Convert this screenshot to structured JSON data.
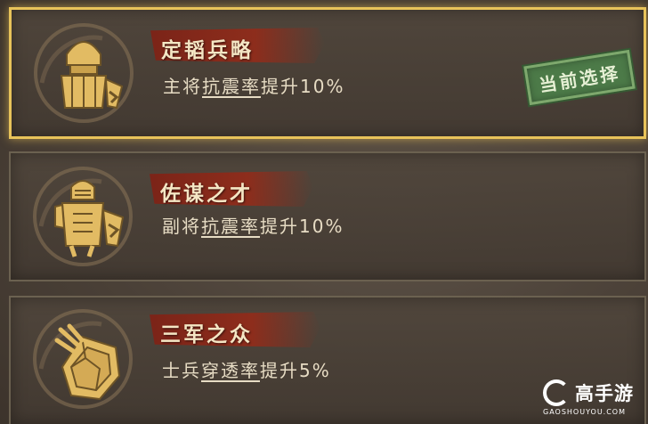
{
  "cards": [
    {
      "icon": "commander-helmet-icon",
      "title": "定韬兵略",
      "desc_prefix": "主将",
      "desc_highlight": "抗震率",
      "desc_suffix": "提升10%",
      "selected": true,
      "stamp": "当前选择"
    },
    {
      "icon": "deputy-warrior-icon",
      "title": "佐谋之才",
      "desc_prefix": "副将",
      "desc_highlight": "抗震率",
      "desc_suffix": "提升10%",
      "selected": false
    },
    {
      "icon": "broken-shield-icon",
      "title": "三军之众",
      "desc_prefix": "士兵",
      "desc_highlight": "穿透率",
      "desc_suffix": "提升5%",
      "selected": false
    }
  ],
  "watermark": {
    "brand": "高手游",
    "url": "GAOSHOUYOU.COM"
  },
  "colors": {
    "selected_border": "#e8c35a",
    "ribbon": "#8d2d1c",
    "stamp": "#4c7a48"
  }
}
